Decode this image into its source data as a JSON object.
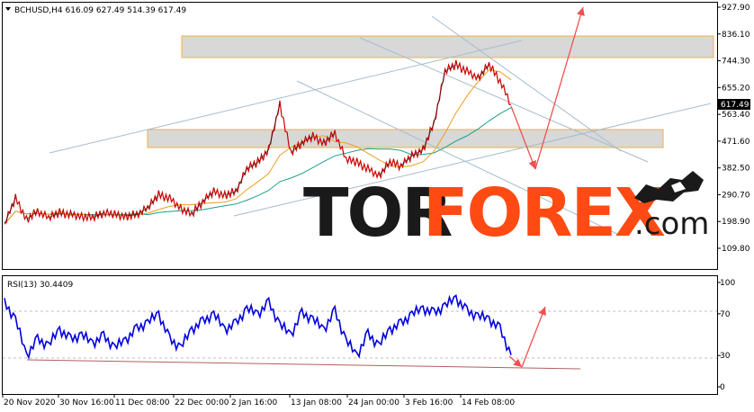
{
  "colors": {
    "background": "#ffffff",
    "price_line": "#cc0000",
    "price_line_up": "#111111",
    "ma_fast": "#e8a020",
    "ma_slow": "#1aa08a",
    "zone_fill": "#d4d4d4",
    "zone_border": "#f0b040",
    "trend_lines": "#a6bccf",
    "forecast_arrow": "#f05050",
    "rsi_line": "#0000dd",
    "rsi_trend": "#b06060",
    "logo_accent": "#ff4a14",
    "logo_dark": "#1a1a1a"
  },
  "price_panel": {
    "header": "BCHUSD,H4  616.09 627.49 514.39 617.49",
    "current_price_label": "617.49",
    "y_ticks": [
      "927.90",
      "836.10",
      "744.30",
      "655.20",
      "563.40",
      "471.60",
      "382.50",
      "290.70",
      "198.90",
      "109.80"
    ]
  },
  "rsi_panel": {
    "header": "RSI(13) 30.4409",
    "y_ticks": [
      "100",
      "70",
      "30",
      "0"
    ]
  },
  "x_ticks": [
    "20 Nov 2020",
    "30 Nov 16:00",
    "11 Dec 08:00",
    "22 Dec 00:00",
    "2 Jan 16:00",
    "13 Jan 08:00",
    "24 Jan 00:00",
    "3 Feb 16:00",
    "14 Feb 08:00"
  ],
  "watermark": {
    "part1": "TOR",
    "part2": "FOREX",
    "part3": ".com",
    "icon": "bull-bear-icon"
  },
  "chart_data": [
    {
      "type": "line",
      "series": [
        {
          "name": "BCHUSD,H4",
          "points": [
            [
              "20 Nov",
              250
            ],
            [
              "22 Nov",
              330
            ],
            [
              "24 Nov",
              265
            ],
            [
              "26 Nov",
              290
            ],
            [
              "28 Nov",
              270
            ],
            [
              "30 Nov",
              285
            ],
            [
              "2 Dec",
              280
            ],
            [
              "4 Dec",
              275
            ],
            [
              "6 Dec",
              270
            ],
            [
              "8 Dec",
              285
            ],
            [
              "10 Dec",
              280
            ],
            [
              "12 Dec",
              275
            ],
            [
              "14 Dec",
              280
            ],
            [
              "16 Dec",
              300
            ],
            [
              "18 Dec",
              340
            ],
            [
              "20 Dec",
              330
            ],
            [
              "22 Dec",
              300
            ],
            [
              "24 Dec",
              280
            ],
            [
              "26 Dec",
              320
            ],
            [
              "28 Dec",
              350
            ],
            [
              "30 Dec",
              340
            ],
            [
              "1 Jan",
              350
            ],
            [
              "3 Jan",
              420
            ],
            [
              "5 Jan",
              440
            ],
            [
              "7 Jan",
              480
            ],
            [
              "9 Jan",
              620
            ],
            [
              "11 Jan",
              470
            ],
            [
              "13 Jan",
              500
            ],
            [
              "15 Jan",
              520
            ],
            [
              "17 Jan",
              500
            ],
            [
              "19 Jan",
              530
            ],
            [
              "21 Jan",
              450
            ],
            [
              "23 Jan",
              440
            ],
            [
              "25 Jan",
              420
            ],
            [
              "27 Jan",
              400
            ],
            [
              "29 Jan",
              440
            ],
            [
              "31 Jan",
              430
            ],
            [
              "2 Feb",
              460
            ],
            [
              "4 Feb",
              480
            ],
            [
              "6 Feb",
              560
            ],
            [
              "8 Feb",
              720
            ],
            [
              "10 Feb",
              740
            ],
            [
              "12 Feb",
              720
            ],
            [
              "14 Feb",
              700
            ],
            [
              "16 Feb",
              740
            ],
            [
              "18 Feb",
              690
            ],
            [
              "20 Feb",
              617.49
            ]
          ]
        }
      ],
      "ylim": [
        109.8,
        927.9
      ]
    },
    {
      "type": "line",
      "series": [
        {
          "name": "RSI(13)",
          "points": [
            [
              "20 Nov",
              80
            ],
            [
              "22 Nov",
              65
            ],
            [
              "24 Nov",
              30
            ],
            [
              "26 Nov",
              45
            ],
            [
              "28 Nov",
              40
            ],
            [
              "30 Nov",
              55
            ],
            [
              "2 Dec",
              45
            ],
            [
              "4 Dec",
              50
            ],
            [
              "6 Dec",
              42
            ],
            [
              "8 Dec",
              48
            ],
            [
              "10 Dec",
              38
            ],
            [
              "12 Dec",
              45
            ],
            [
              "14 Dec",
              55
            ],
            [
              "16 Dec",
              62
            ],
            [
              "18 Dec",
              70
            ],
            [
              "20 Dec",
              45
            ],
            [
              "22 Dec",
              38
            ],
            [
              "24 Dec",
              55
            ],
            [
              "26 Dec",
              62
            ],
            [
              "28 Dec",
              70
            ],
            [
              "30 Dec",
              55
            ],
            [
              "1 Jan",
              60
            ],
            [
              "3 Jan",
              75
            ],
            [
              "5 Jan",
              70
            ],
            [
              "7 Jan",
              80
            ],
            [
              "9 Jan",
              60
            ],
            [
              "11 Jan",
              50
            ],
            [
              "13 Jan",
              70
            ],
            [
              "15 Jan",
              65
            ],
            [
              "17 Jan",
              55
            ],
            [
              "19 Jan",
              72
            ],
            [
              "21 Jan",
              45
            ],
            [
              "23 Jan",
              30
            ],
            [
              "25 Jan",
              50
            ],
            [
              "27 Jan",
              40
            ],
            [
              "29 Jan",
              55
            ],
            [
              "31 Jan",
              60
            ],
            [
              "2 Feb",
              70
            ],
            [
              "4 Feb",
              75
            ],
            [
              "6 Feb",
              70
            ],
            [
              "8 Feb",
              78
            ],
            [
              "10 Feb",
              85
            ],
            [
              "12 Feb",
              72
            ],
            [
              "14 Feb",
              68
            ],
            [
              "16 Feb",
              65
            ],
            [
              "18 Feb",
              55
            ],
            [
              "20 Feb",
              30.4409
            ]
          ]
        }
      ],
      "ylim": [
        0,
        100
      ]
    }
  ]
}
